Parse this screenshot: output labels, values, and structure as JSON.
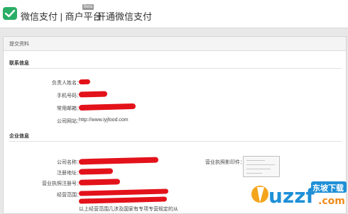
{
  "header": {
    "title": "微信支付 | 商户平台",
    "beta_tag": "Beta",
    "subtitle": "开通微信支付"
  },
  "panel": {
    "heading": "提交资料"
  },
  "contact": {
    "section_title": "联系信息",
    "name_label": "负责人姓名：",
    "phone_label": "手机号码：",
    "email_label": "常用邮箱：",
    "website_label": "公司网站：",
    "website_value": "http://www.iyjfood.com"
  },
  "company": {
    "section_title": "企业信息",
    "name_label": "公司名称：",
    "address_label": "注册地址：",
    "license_no_label": "营业执照注册号：",
    "scope_label": "经营范围：",
    "license_copy_label": "营业执照影印件：",
    "scope_note": "以上经营范围几涉及国家有专项专营规定的从"
  },
  "watermark": {
    "brand": "uzzf",
    "tagline": "东坡下载",
    "url": ".com"
  },
  "colors": {
    "wechat_green": "#2aae67",
    "redaction": "#e3121a",
    "watermark_blue": "#1e8fd6",
    "watermark_orange": "#f08a1c"
  }
}
